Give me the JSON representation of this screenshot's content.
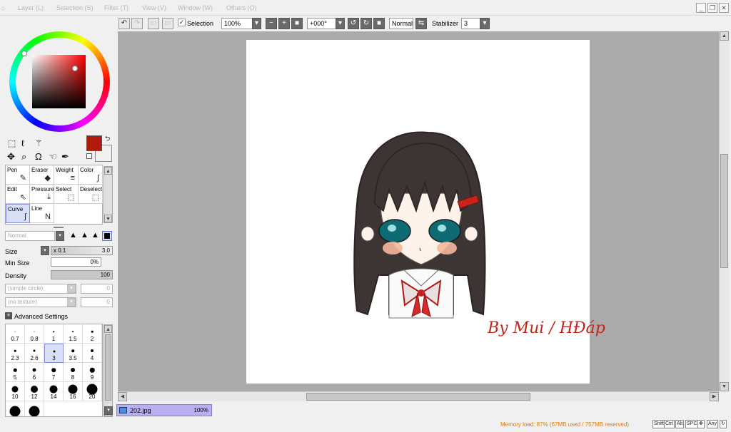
{
  "menubar": {
    "first": "⌂",
    "items": [
      "Layer (L)",
      "Selection (S)",
      "Filter (T)",
      "View (V)",
      "Window (W)",
      "Others (O)"
    ],
    "window_buttons": [
      "_",
      "❐",
      "✕"
    ]
  },
  "toolbar": {
    "selection_checkbox_label": "Selection",
    "zoom_value": "100%",
    "rotation_value": "+000°",
    "blend_mode": "Normal",
    "stabilizer_label": "Stabilizer",
    "stabilizer_value": "3"
  },
  "color": {
    "foreground": "#b01a0c",
    "background": "#ffffff"
  },
  "tools": [
    {
      "name": "Pen"
    },
    {
      "name": "Eraser"
    },
    {
      "name": "Weight"
    },
    {
      "name": "Color"
    },
    {
      "name": "Edit"
    },
    {
      "name": "Pressure"
    },
    {
      "name": "Select"
    },
    {
      "name": "Deselect"
    },
    {
      "name": "Curve"
    },
    {
      "name": "Line"
    }
  ],
  "brush": {
    "blend_mode": "Normal",
    "size_label": "Size",
    "size_multiplier": "x 0.1",
    "size_value": "3.0",
    "min_size_label": "Min Size",
    "min_size_value": "0%",
    "density_label": "Density",
    "density_value": "100",
    "shape_placeholder": "(simple circle)",
    "shape_value": "0",
    "texture_placeholder": "(no texture)",
    "texture_value": "0",
    "advanced_label": "Advanced Settings",
    "sizes": [
      "0.7",
      "0.8",
      "1",
      "1.5",
      "2",
      "2.3",
      "2.6",
      "3",
      "3.5",
      "4",
      "5",
      "6",
      "7",
      "8",
      "9",
      "10",
      "12",
      "14",
      "16",
      "20",
      "",
      ""
    ],
    "selected_size": "3"
  },
  "canvas": {
    "signature": "By Mui / HĐáp"
  },
  "tab": {
    "file_name": "202.jpg",
    "zoom": "100%"
  },
  "status": {
    "memory": "Memory load: 87% (67MB used / 757MB reserved)",
    "memory_color": "#e07800",
    "keys": [
      "Shift",
      "Ctrl",
      "Alt",
      "SPC",
      "✥",
      "Any",
      "↻"
    ]
  }
}
